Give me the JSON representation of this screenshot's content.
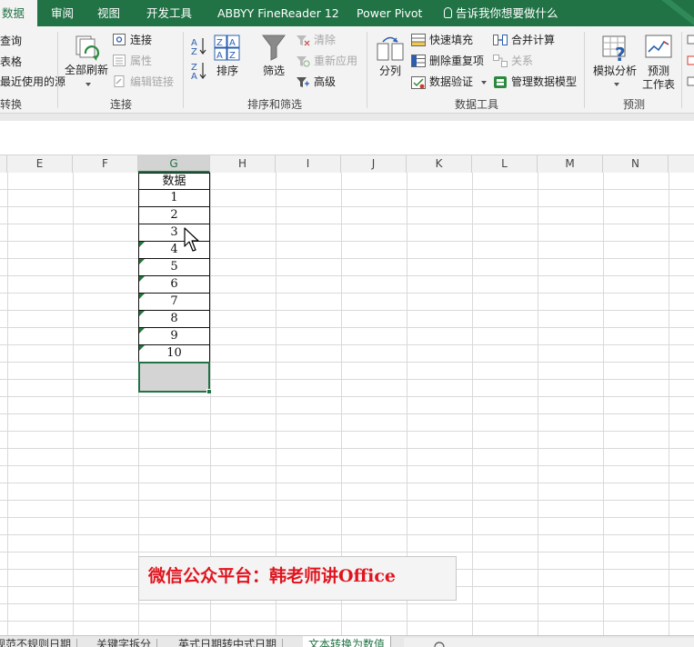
{
  "ribbon_tabs": {
    "active": "数据",
    "review": "审阅",
    "view": "视图",
    "developer": "开发工具",
    "abbyy": "ABBYY FineReader 12",
    "powerpivot": "Power Pivot",
    "tellme": "告诉我你想要做什么"
  },
  "groups": {
    "get_transform": {
      "label": "转换",
      "items": [
        "查询",
        "表格",
        "最近使用的源"
      ]
    },
    "connections": {
      "label": "连接",
      "refresh_all": "全部刷新",
      "connections": "连接",
      "properties": "属性",
      "edit_links": "编辑链接"
    },
    "sort_filter": {
      "label": "排序和筛选",
      "sort": "排序",
      "filter": "筛选",
      "clear": "清除",
      "reapply": "重新应用",
      "advanced": "高级"
    },
    "data_tools": {
      "label": "数据工具",
      "text_to_columns": "分列",
      "flash_fill": "快速填充",
      "remove_duplicates": "删除重复项",
      "data_validation": "数据验证",
      "consolidate": "合并计算",
      "relationships": "关系",
      "manage_data_model": "管理数据模型"
    },
    "forecast": {
      "label": "预测",
      "what_if": "模拟分析",
      "forecast_sheet_line1": "预测",
      "forecast_sheet_line2": "工作表"
    }
  },
  "columns": [
    "E",
    "F",
    "G",
    "H",
    "I",
    "J",
    "K",
    "L",
    "M",
    "N"
  ],
  "selected_column": "G",
  "cells": {
    "header": "数据",
    "values": [
      "1",
      "2",
      "3",
      "4",
      "5",
      "6",
      "7",
      "8",
      "9",
      "10"
    ],
    "text_number_flag_rows": [
      4,
      5,
      6,
      7,
      8,
      9,
      10
    ]
  },
  "watermark": "微信公众平台：韩老师讲Office",
  "sheet_tabs": [
    "规范不规则日期",
    "关键字拆分",
    "英式日期转中式日期",
    "文本转换为数值"
  ],
  "active_sheet_tab": "文本转换为数值",
  "colors": {
    "accent": "#217346",
    "watermark_text": "#e0141e",
    "error_triangle": "#1e7a3a"
  }
}
